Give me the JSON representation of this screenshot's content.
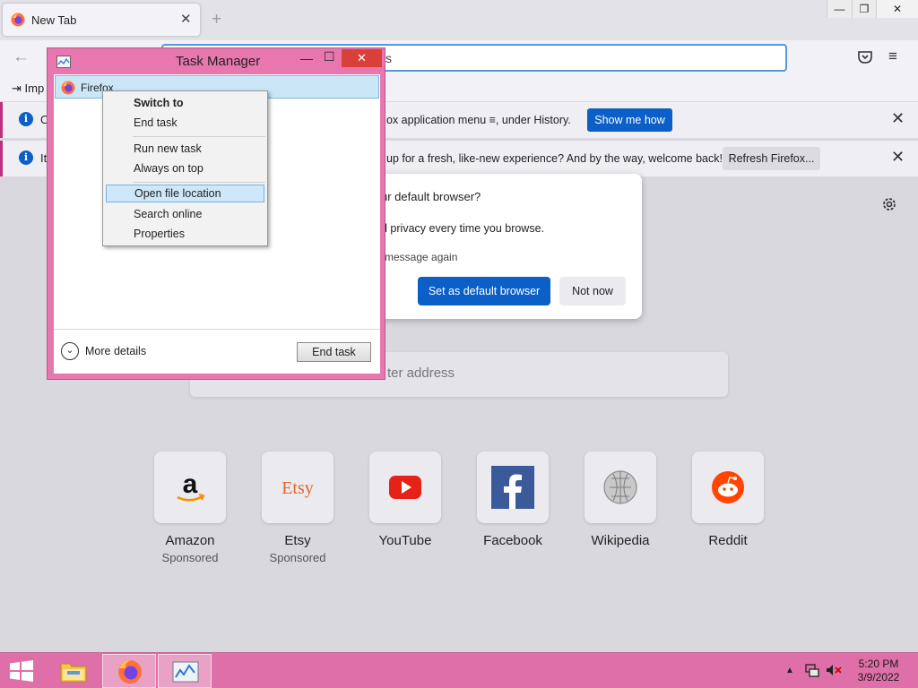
{
  "browser": {
    "tab": {
      "title": "New Tab",
      "close": "✕"
    },
    "new_tab": "+",
    "window_controls": {
      "minimize": "—",
      "maximize": "❐",
      "close": "✕"
    },
    "back": "←",
    "url_text": "s",
    "bookmarks_import": "Imp",
    "menu_glyph": "≡"
  },
  "notifications": [
    {
      "lead": "O",
      "message": "ox application menu ≡, under History.",
      "button": "Show me how",
      "close": "✕"
    },
    {
      "lead": "It",
      "message": "up for a fresh, like-new experience? And by the way, welcome back!",
      "button": "Refresh Firefox...",
      "close": "✕"
    }
  ],
  "default_dialog": {
    "question": "ur default browser?",
    "subtitle": "d privacy every time you browse.",
    "checkbox_label": "message again",
    "primary_button": "Set as default browser",
    "secondary_button": "Not now"
  },
  "search": {
    "placeholder": "ter address"
  },
  "top_sites": [
    {
      "name": "Amazon",
      "sponsored": "Sponsored",
      "icon": "amazon-icon"
    },
    {
      "name": "Etsy",
      "sponsored": "Sponsored",
      "icon": "etsy-icon"
    },
    {
      "name": "YouTube",
      "sponsored": "",
      "icon": "youtube-icon"
    },
    {
      "name": "Facebook",
      "sponsored": "",
      "icon": "facebook-icon"
    },
    {
      "name": "Wikipedia",
      "sponsored": "",
      "icon": "wikipedia-icon"
    },
    {
      "name": "Reddit",
      "sponsored": "",
      "icon": "reddit-icon"
    }
  ],
  "task_manager": {
    "title": "Task Manager",
    "controls": {
      "minimize": "—",
      "maximize": "☐",
      "close": "✕"
    },
    "process": "Firefox",
    "more_details": "More details",
    "more_details_glyph": "⌄",
    "end_task": "End task"
  },
  "context_menu": {
    "items": [
      "Switch to",
      "End task",
      "Run new task",
      "Always on top",
      "Open file location",
      "Search online",
      "Properties"
    ],
    "highlighted": "Open file location"
  },
  "taskbar": {
    "time": "5:20 PM",
    "date": "3/9/2022",
    "tray_arrow": "▲"
  },
  "colors": {
    "accent_blue": "#0b5fc6",
    "taskbar_pink": "#df6fa8",
    "window_frame_pink": "#e877b0",
    "close_red": "#d9403a"
  }
}
